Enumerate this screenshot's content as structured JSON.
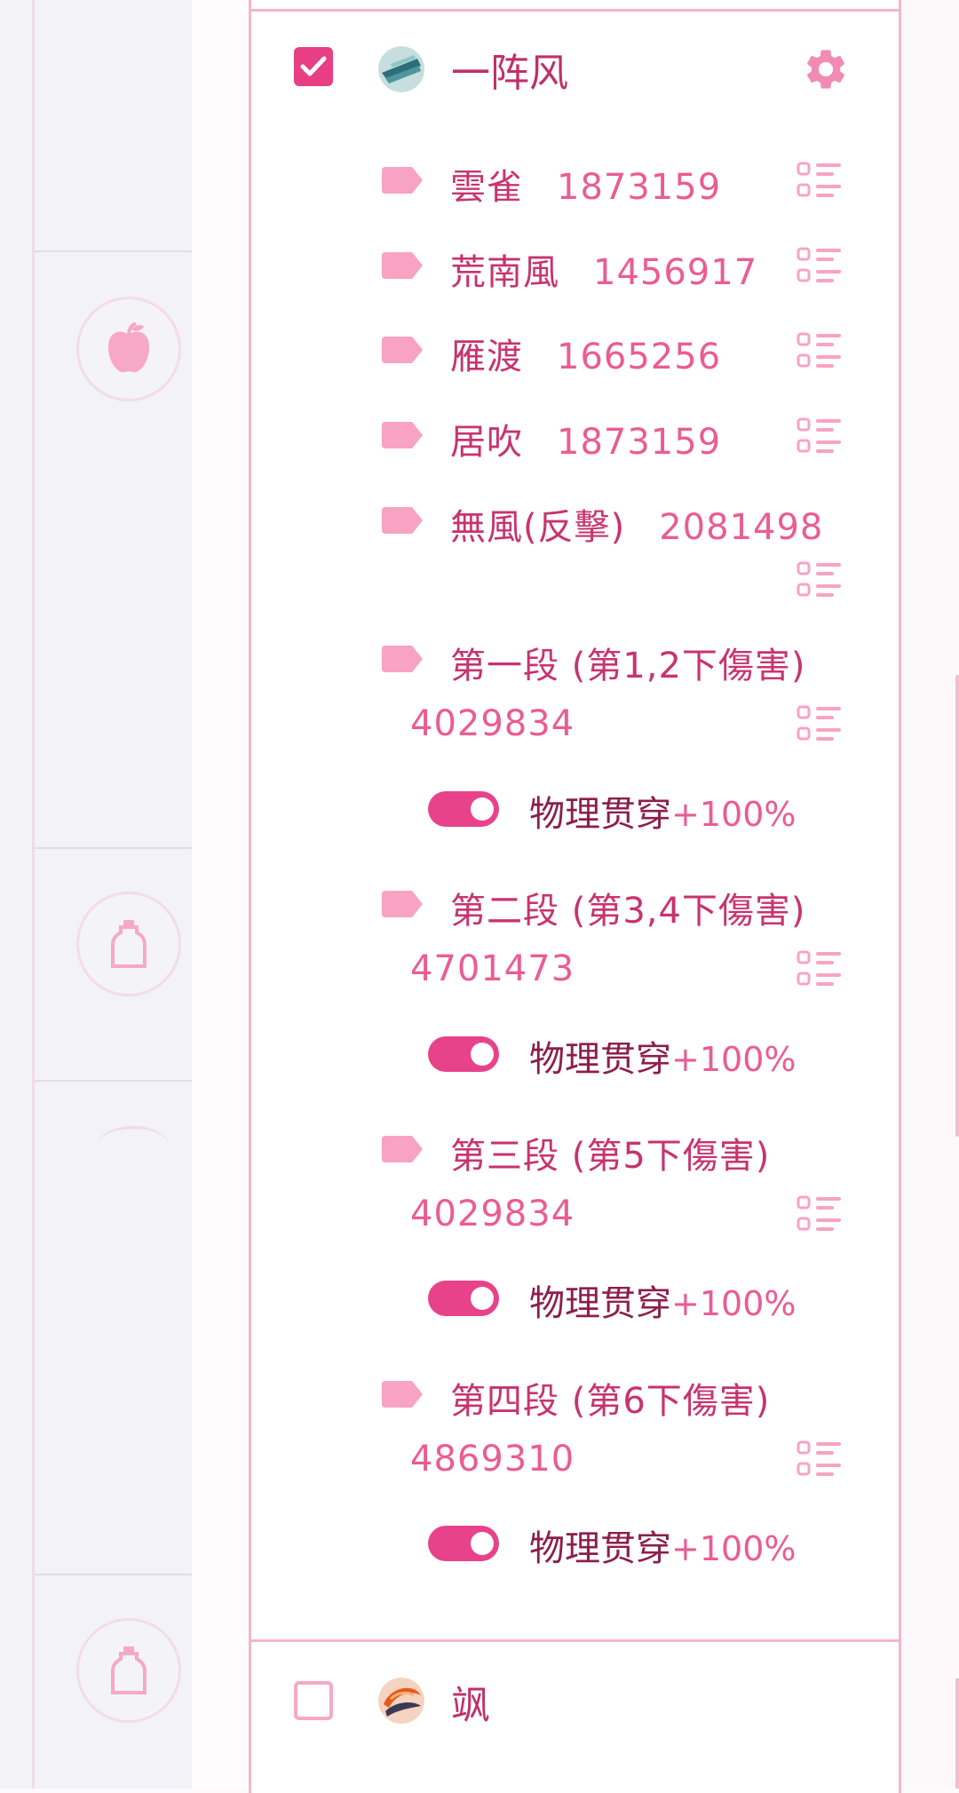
{
  "character1": {
    "name": "一阵风",
    "checked": true,
    "skills": [
      {
        "name": "雲雀",
        "value": "1873159"
      },
      {
        "name": "荒南風",
        "value": "1456917"
      },
      {
        "name": "雁渡",
        "value": "1665256"
      },
      {
        "name": "居吹",
        "value": "1873159"
      },
      {
        "name": "無風(反擊)",
        "value": "2081498"
      },
      {
        "name": "第一段 (第1,2下傷害)",
        "value": "4029834",
        "toggle": {
          "label": "物理贯穿",
          "value": "+100%",
          "on": true
        }
      },
      {
        "name": "第二段 (第3,4下傷害)",
        "value": "4701473",
        "toggle": {
          "label": "物理贯穿",
          "value": "+100%",
          "on": true
        }
      },
      {
        "name": "第三段 (第5下傷害)",
        "value": "4029834",
        "toggle": {
          "label": "物理贯穿",
          "value": "+100%",
          "on": true
        }
      },
      {
        "name": "第四段 (第6下傷害)",
        "value": "4869310",
        "toggle": {
          "label": "物理贯穿",
          "value": "+100%",
          "on": true
        }
      }
    ]
  },
  "character2": {
    "name": "飒",
    "checked": false
  },
  "colors": {
    "accent": "#e83e83",
    "tag": "#f8a3c3",
    "border": "#f3b6cc"
  },
  "icons": {
    "rail": [
      "apple-icon",
      "bottle-icon",
      "bottle-icon"
    ],
    "header": "gear-icon",
    "row": "list-icon",
    "label": "tag-icon"
  }
}
